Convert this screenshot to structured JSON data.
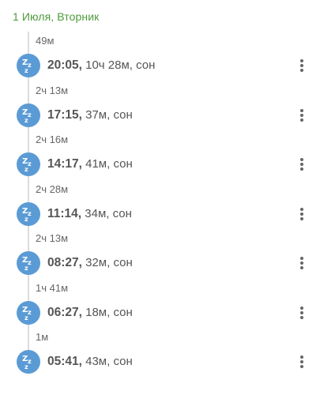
{
  "day": {
    "title": "1 Июля, Вторник"
  },
  "entries": [
    {
      "gap": "49м",
      "time": "20:05,",
      "detail": "10ч 28м, сон"
    },
    {
      "gap": "2ч 13м",
      "time": "17:15,",
      "detail": "37м, сон"
    },
    {
      "gap": "2ч 16м",
      "time": "14:17,",
      "detail": "41м, сон"
    },
    {
      "gap": "2ч 28м",
      "time": "11:14,",
      "detail": "34м, сон"
    },
    {
      "gap": "2ч 13м",
      "time": "08:27,",
      "detail": "32м, сон"
    },
    {
      "gap": "1ч 41м",
      "time": "06:27,",
      "detail": "18м, сон"
    },
    {
      "gap": "1м",
      "time": "05:41,",
      "detail": "43м, сон"
    }
  ],
  "icons": {
    "entry_icon": "sleep-zz-icon",
    "menu_icon": "more-vertical-icon"
  },
  "colors": {
    "header": "#4e9a3c",
    "icon_bg": "#5b9bd5"
  }
}
